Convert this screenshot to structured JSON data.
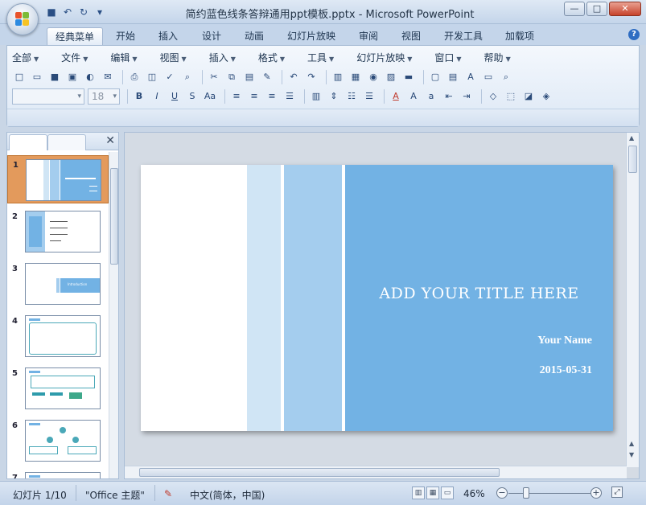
{
  "window": {
    "title": "简约蓝色线条答辩通用ppt模板.pptx - Microsoft PowerPoint",
    "minimize": "—",
    "maximize": "□",
    "close": "✕"
  },
  "ribbon_tabs": [
    {
      "label": "经典菜单"
    },
    {
      "label": "开始"
    },
    {
      "label": "插入"
    },
    {
      "label": "设计"
    },
    {
      "label": "动画"
    },
    {
      "label": "幻灯片放映"
    },
    {
      "label": "审阅"
    },
    {
      "label": "视图"
    },
    {
      "label": "开发工具"
    },
    {
      "label": "加载项"
    }
  ],
  "menu": [
    {
      "label": "全部"
    },
    {
      "label": "文件"
    },
    {
      "label": "编辑"
    },
    {
      "label": "视图"
    },
    {
      "label": "插入"
    },
    {
      "label": "格式"
    },
    {
      "label": "工具"
    },
    {
      "label": "幻灯片放映"
    },
    {
      "label": "窗口"
    },
    {
      "label": "帮助"
    }
  ],
  "font_size": "18",
  "thumbnails": [
    {
      "num": "1"
    },
    {
      "num": "2"
    },
    {
      "num": "3",
      "text": "Introduction"
    },
    {
      "num": "4"
    },
    {
      "num": "5"
    },
    {
      "num": "6"
    },
    {
      "num": "7"
    }
  ],
  "slide": {
    "title": "ADD YOUR TITLE  HERE",
    "name": "Your Name",
    "date": "2015-05-31"
  },
  "status": {
    "slide_info": "幻灯片 1/10",
    "theme": "\"Office 主题\"",
    "language": "中文(简体，中国)",
    "zoom": "46%"
  },
  "colors": {
    "band_light": "#d0e5f5",
    "band_mid": "#a4cdee",
    "band_main": "#72b2e4",
    "selection": "#e39a5c"
  }
}
